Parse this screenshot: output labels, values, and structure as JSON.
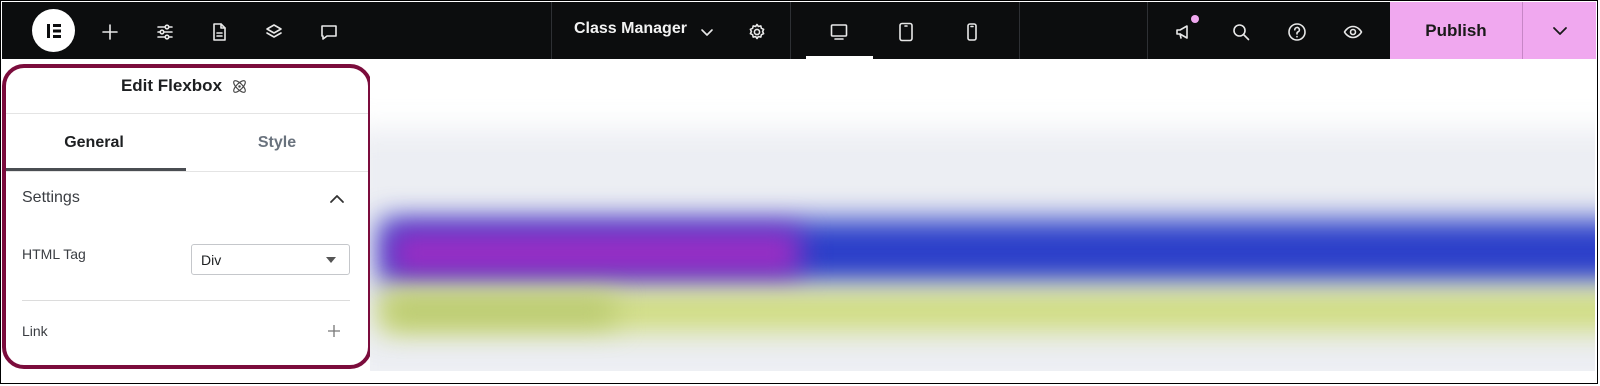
{
  "topbar": {
    "logo_icon": "elementor-logo-icon",
    "left_icons": [
      "plus-icon",
      "sliders-icon",
      "page-icon",
      "layers-icon",
      "comment-icon"
    ],
    "class_manager_label": "Class Manager",
    "devices": [
      "desktop-icon",
      "tablet-icon",
      "mobile-icon"
    ],
    "active_device": "desktop",
    "right_icons": [
      "megaphone-icon",
      "search-icon",
      "help-icon",
      "eye-icon"
    ],
    "publish_label": "Publish",
    "accent_color": "#f0a8ef"
  },
  "panel": {
    "title": "Edit Flexbox",
    "tabs": [
      {
        "label": "General",
        "active": true
      },
      {
        "label": "Style",
        "active": false
      }
    ],
    "section": {
      "title": "Settings",
      "html_tag_label": "HTML Tag",
      "html_tag_value": "Div",
      "link_label": "Link"
    },
    "highlight_color": "#7b0c3c"
  }
}
